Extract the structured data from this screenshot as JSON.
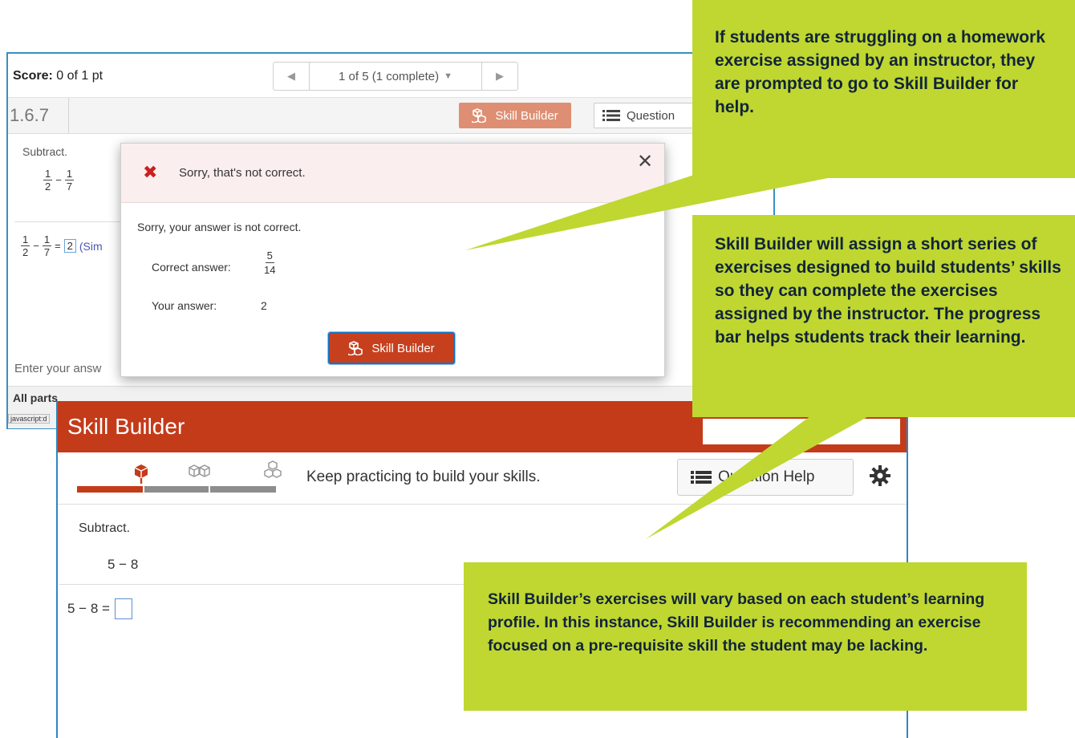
{
  "homework": {
    "score_label": "Score:",
    "score_value": "0 of 1 pt",
    "nav_label": "1 of 5 (1 complete)",
    "section": "1.6.7",
    "skill_builder_label": "Skill Builder",
    "question_help_label": "Question",
    "instruction": "Subtract.",
    "expr_a": {
      "num": "1",
      "den": "2"
    },
    "expr_b": {
      "num": "1",
      "den": "7"
    },
    "answer_value": "2",
    "answer_note": "(Sim",
    "enter_prompt": "Enter your answ",
    "all_parts": "All parts",
    "status_link": "javascript:d"
  },
  "modal": {
    "title": "Sorry, that's not correct.",
    "message": "Sorry, your answer is not correct.",
    "correct_label": "Correct answer:",
    "correct_num": "5",
    "correct_den": "14",
    "your_label": "Your answer:",
    "your_value": "2",
    "button_label": "Skill Builder",
    "close_glyph": "✕"
  },
  "skill_builder": {
    "title": "Skill Builder",
    "status": "Keep practicing to build your skills.",
    "question_help_label": "Question Help",
    "progress_fraction": 0.33,
    "instruction": "Subtract.",
    "expression": "5 − 8",
    "equation_prefix": "5 − 8 ="
  },
  "callouts": {
    "c1": "If students are struggling on a homework exercise assigned by an instructor, they are prompted to go to Skill Builder for help.",
    "c2": "Skill Builder will assign a short series of exercises designed to build students’ skills so they can complete the exercises assigned by the instructor. The progress bar helps students track their learning.",
    "c3": "Skill Builder’s exercises will vary based on each student’s learning profile.  In this instance, Skill Builder is recommending an exercise focused on a pre-requisite skill the student may be lacking."
  },
  "colors": {
    "callout": "#bfd730",
    "skill_builder_red": "#c43b1a",
    "window_border": "#2e86c1"
  },
  "icons": [
    "left-triangle-icon",
    "right-triangle-icon",
    "dropdown-caret-icon",
    "cubes-icon",
    "list-icon",
    "x-mark-icon",
    "close-icon",
    "single-cube-icon",
    "double-cube-icon",
    "gear-icon"
  ]
}
